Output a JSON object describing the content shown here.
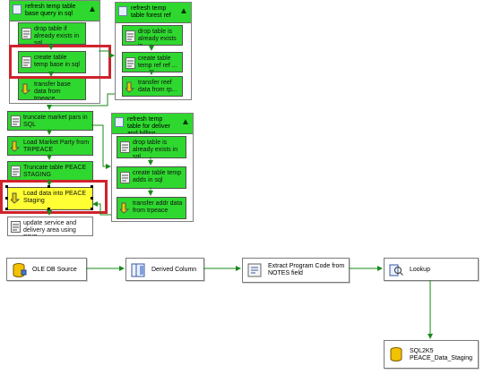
{
  "control_flow": {
    "container_left": {
      "title": "refresh temp table base query in sql",
      "tasks": [
        {
          "label": "drop table if already exists in sql"
        },
        {
          "label": "create table temp base in sql"
        },
        {
          "label": "transfer base data from trpeace"
        }
      ]
    },
    "container_mid": {
      "title": "refresh temp table forest ref ...",
      "tasks": [
        {
          "label": "drop table is already exists in..."
        },
        {
          "label": "create table temp ref ref ..."
        },
        {
          "label": "transfer reef data from rp..."
        }
      ]
    },
    "container_right": {
      "title": "refresh temp table for deliver and billing",
      "tasks": [
        {
          "label": "drop table is already exists in sql"
        },
        {
          "label": "create table temp adds in sql"
        },
        {
          "label": "transfer addr data from trpeace"
        }
      ]
    },
    "standalone_tasks": [
      {
        "label": "truncate market pars in SQL"
      },
      {
        "label": "Load Market Party from TRPEACE"
      },
      {
        "label": "Truncate table PEACE STAGING"
      },
      {
        "label": "Load data into PEACE Staging"
      },
      {
        "label": "update service and delivery area using PPID"
      }
    ]
  },
  "data_flow": {
    "nodes": [
      {
        "label": "OLE DB Source",
        "icon": "ole-db-source-icon"
      },
      {
        "label": "Derived Column",
        "icon": "derived-column-icon"
      },
      {
        "label": "Extract Program Code from NOTES field",
        "icon": "script-component-icon"
      },
      {
        "label": "Lookup",
        "icon": "lookup-icon"
      },
      {
        "label": "SQL2K5 PEACE_Data_Staging",
        "icon": "sql-destination-icon"
      }
    ]
  },
  "colors": {
    "task_success": "#2fd82f",
    "task_selected": "#ffff33",
    "highlight_box": "#d0232b",
    "connector": "#1a8a1a"
  }
}
